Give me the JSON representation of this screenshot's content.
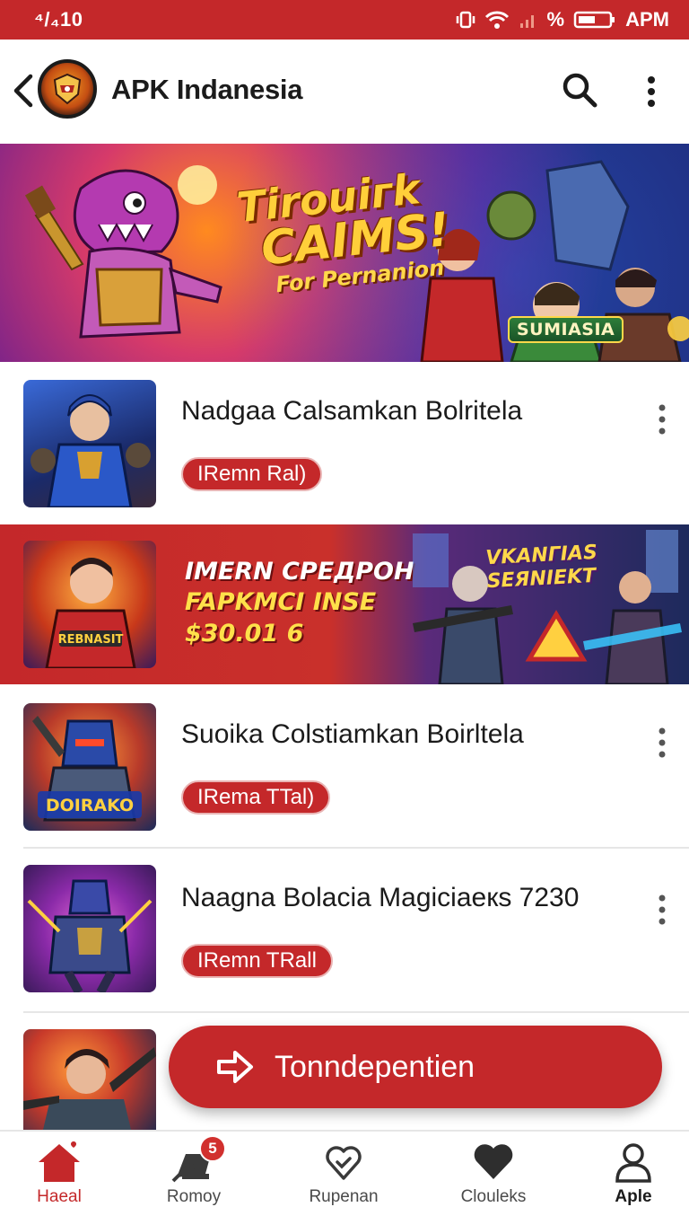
{
  "status_bar": {
    "time": "⁴/₄10",
    "network": "APM",
    "battery_glyph": "%"
  },
  "app_bar": {
    "title": "APK Indanesia"
  },
  "hero": {
    "line1": "Tirouiгk",
    "line2": "CAIMS!",
    "line3": "For Pernanion",
    "badge": "SUMIASIA"
  },
  "rows": [
    {
      "title": "Nadgaa Calsamkan Bolritela",
      "chip": "IRemn Ral)"
    },
    {
      "title": "Suoika Colstiamkan Boirltela",
      "chip": "IRema TTal)",
      "thumb_caption": "DOIRAKO"
    },
    {
      "title": "Naagna Bolacia Magiciaeкs 7230",
      "chip": "IRemn TRall"
    }
  ],
  "promo": {
    "line1": "IMERN CPEДPOH",
    "line2": "FAPKMCI INSE",
    "line3": "$30.01 6",
    "art_title_1": "VKANГIAS",
    "art_title_2": "SEЯNIEKT",
    "thumb_caption": "REBNASIT"
  },
  "fab": {
    "label": "Tonndepentien"
  },
  "bottom_nav": {
    "items": [
      {
        "label": "Haeal",
        "icon": "home-icon",
        "active": true
      },
      {
        "label": "Romoy",
        "icon": "cart-icon",
        "badge": "5"
      },
      {
        "label": "Rupenan",
        "icon": "heart-check-icon"
      },
      {
        "label": "Clouleks",
        "icon": "heart-icon"
      },
      {
        "label": "Aple",
        "icon": "profile-icon"
      }
    ]
  },
  "colors": {
    "brand_red": "#c4282a",
    "text": "#1b1b1b",
    "divider": "#e6e6e6"
  }
}
